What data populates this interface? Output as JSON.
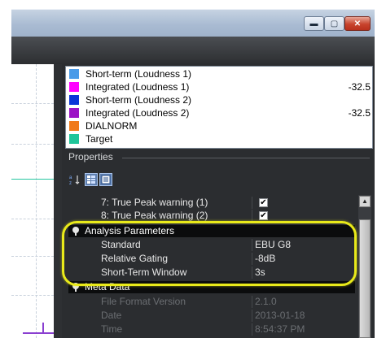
{
  "legend": {
    "items": [
      {
        "label": "Short-term (Loudness 1)",
        "value": "",
        "color": "#4a9be8"
      },
      {
        "label": "Integrated (Loudness 1)",
        "value": "-32.5",
        "color": "#ff00ff"
      },
      {
        "label": "Short-term (Loudness 2)",
        "value": "",
        "color": "#0a35d8"
      },
      {
        "label": "Integrated (Loudness 2)",
        "value": "-32.5",
        "color": "#9c12c6"
      },
      {
        "label": "DIALNORM",
        "value": "",
        "color": "#f07a1a"
      },
      {
        "label": "Target",
        "value": "",
        "color": "#1fc59a"
      }
    ]
  },
  "properties": {
    "title": "Properties",
    "toolbar": {
      "sort_icon": "sort-az-icon",
      "categorized_icon": "categorized-icon",
      "property_pages_icon": "property-pages-icon"
    },
    "rows": {
      "true_peak_1": {
        "name": "7: True Peak warning (1)",
        "checked": true
      },
      "true_peak_2": {
        "name": "8: True Peak warning (2)",
        "checked": true
      },
      "analysis_category": "Analysis Parameters",
      "standard": {
        "name": "Standard",
        "value": "EBU G8"
      },
      "relative_gating": {
        "name": "Relative Gating",
        "value": "-8dB"
      },
      "short_term_window": {
        "name": "Short-Term Window",
        "value": "3s"
      },
      "meta_category": "Meta Data",
      "file_format_version": {
        "name": "File Format Version",
        "value": "2.1.0"
      },
      "date": {
        "name": "Date",
        "value": "2013-01-18"
      },
      "time": {
        "name": "Time",
        "value": "8:54:37 PM"
      }
    }
  },
  "window_buttons": {
    "minimize": "minimize-icon",
    "maximize": "maximize-icon",
    "close": "close-icon"
  },
  "colors": {
    "highlight": "#e9ea1a",
    "panel_bg": "#2b2d30",
    "category_bg": "#0b0c0d",
    "trace_teal": "#26c6a0",
    "trace_purple": "#8a3fd0"
  }
}
